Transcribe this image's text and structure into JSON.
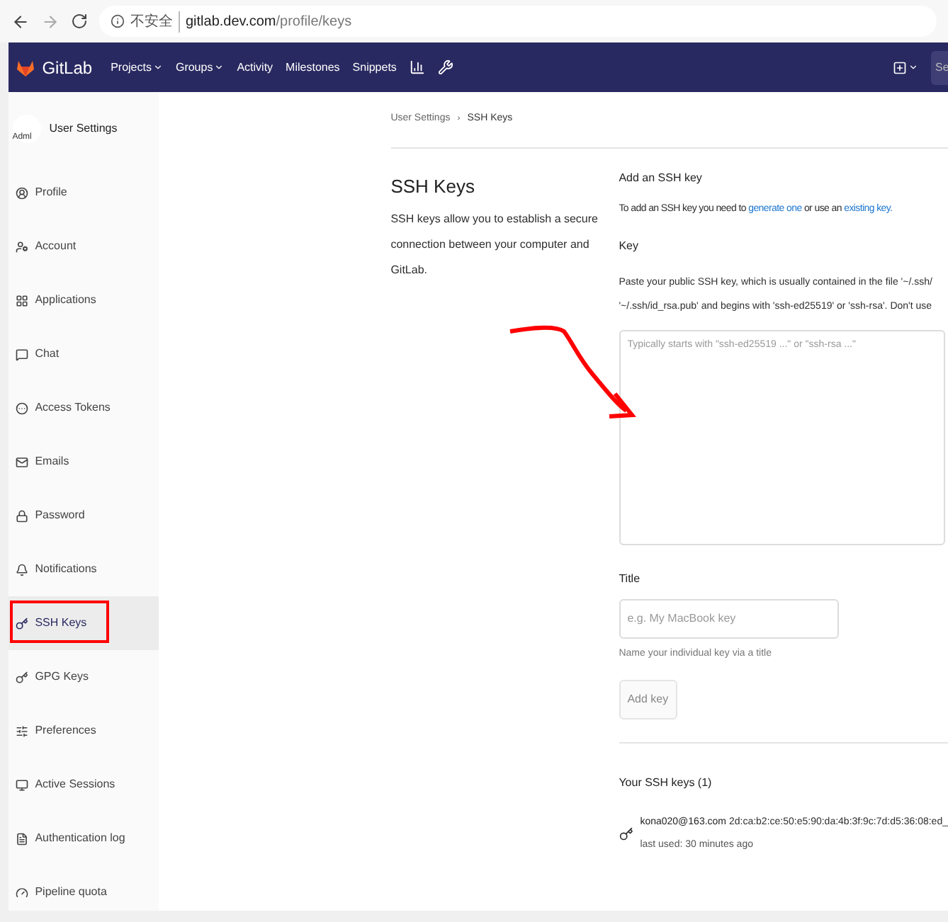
{
  "browser": {
    "security": "不安全",
    "host": "gitlab.dev.com",
    "path": "/profile/keys"
  },
  "navbar": {
    "brand": "GitLab",
    "items": [
      {
        "label": "Projects",
        "dropdown": true
      },
      {
        "label": "Groups",
        "dropdown": true
      },
      {
        "label": "Activity",
        "dropdown": false
      },
      {
        "label": "Milestones",
        "dropdown": false
      },
      {
        "label": "Snippets",
        "dropdown": false
      }
    ],
    "search_placeholder": "Se"
  },
  "sidebar": {
    "avatar_alt": "Adml",
    "title": "User Settings",
    "items": [
      {
        "label": "Profile",
        "selected": false
      },
      {
        "label": "Account",
        "selected": false
      },
      {
        "label": "Applications",
        "selected": false
      },
      {
        "label": "Chat",
        "selected": false
      },
      {
        "label": "Access Tokens",
        "selected": false
      },
      {
        "label": "Emails",
        "selected": false
      },
      {
        "label": "Password",
        "selected": false
      },
      {
        "label": "Notifications",
        "selected": false
      },
      {
        "label": "SSH Keys",
        "selected": true
      },
      {
        "label": "GPG Keys",
        "selected": false
      },
      {
        "label": "Preferences",
        "selected": false
      },
      {
        "label": "Active Sessions",
        "selected": false
      },
      {
        "label": "Authentication log",
        "selected": false
      },
      {
        "label": "Pipeline quota",
        "selected": false
      }
    ]
  },
  "breadcrumb": [
    "User Settings",
    "SSH Keys"
  ],
  "breadcrumb_separator": "›",
  "intro": {
    "title": "SSH Keys",
    "description": "SSH keys allow you to establish a secure connection between your computer and GitLab."
  },
  "form": {
    "heading": "Add an SSH key",
    "text_before": "To add an SSH key you need to",
    "link_1": "generate one",
    "text_middle": "or use an",
    "link_2": "existing key.",
    "key_label": "Key",
    "key_help": "Paste your public SSH key, which is usually contained in the file '~/.ssh/",
    "key_help_2": "'~/.ssh/id_rsa.pub' and begins with 'ssh-ed25519' or 'ssh-rsa'. Don't use",
    "key_placeholder": "Typically starts with \"ssh-ed25519 ...\" or \"ssh-rsa ...\"",
    "title_label": "Title",
    "title_placeholder": "e.g. My MacBook key",
    "title_help": "Name your individual key via a title",
    "button": "Add key",
    "button_disabled": true
  },
  "keys": {
    "heading": "Your SSH keys (1)",
    "items": [
      {
        "title": "kona020@163.com",
        "fingerprint": "2d:ca:b2:ce:50:e5:90:da:4b:3f:9c:7d:d5:36:08:ed_",
        "last_used": "last used: 30 minutes ago"
      }
    ]
  }
}
